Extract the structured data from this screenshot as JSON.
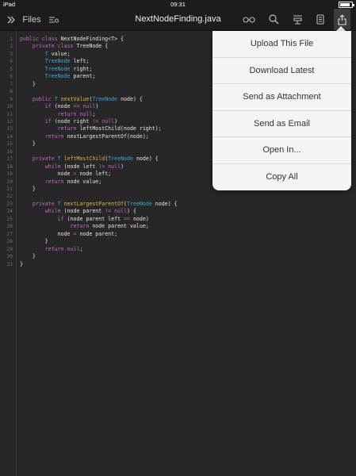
{
  "status_bar": {
    "device": "iPad",
    "time": "09:31"
  },
  "toolbar": {
    "files_label": "Files",
    "title": "NextNodeFinding.java",
    "icons": [
      "chevron-double-right-icon",
      "sort-list-icon",
      "glasses-icon",
      "search-icon",
      "snippets-icon",
      "document-icon",
      "share-icon"
    ]
  },
  "menu": {
    "items": [
      "Upload This File",
      "Download Latest",
      "Send as Attachment",
      "Send as Email",
      "Open In...",
      "Copy All"
    ]
  },
  "code": {
    "lines": [
      [
        [
          "kw",
          "public class "
        ],
        [
          "pl",
          "NextNodeFinding<T> {"
        ]
      ],
      [
        [
          "pl",
          "    "
        ],
        [
          "kw",
          "private class "
        ],
        [
          "pl",
          "TreeNode {"
        ]
      ],
      [
        [
          "pl",
          "        "
        ],
        [
          "ty",
          "T"
        ],
        [
          "pl",
          " value;"
        ]
      ],
      [
        [
          "pl",
          "        "
        ],
        [
          "ty",
          "TreeNode"
        ],
        [
          "pl",
          " left;"
        ]
      ],
      [
        [
          "pl",
          "        "
        ],
        [
          "ty",
          "TreeNode"
        ],
        [
          "pl",
          " right;"
        ]
      ],
      [
        [
          "pl",
          "        "
        ],
        [
          "ty",
          "TreeNode"
        ],
        [
          "pl",
          " parent;"
        ]
      ],
      [
        [
          "pl",
          "    }"
        ]
      ],
      [
        [
          "pl",
          ""
        ]
      ],
      [
        [
          "pl",
          "    "
        ],
        [
          "kw",
          "public "
        ],
        [
          "ty",
          "T "
        ],
        [
          "fn",
          "nextValue"
        ],
        [
          "pl",
          "("
        ],
        [
          "ty",
          "TreeNode"
        ],
        [
          "pl",
          " node) {"
        ]
      ],
      [
        [
          "pl",
          "        "
        ],
        [
          "kw",
          "if"
        ],
        [
          "pl",
          " (node "
        ],
        [
          "kw",
          "=="
        ],
        [
          "pl",
          " "
        ],
        [
          "kw",
          "null"
        ],
        [
          "pl",
          ")"
        ]
      ],
      [
        [
          "pl",
          "            "
        ],
        [
          "kw",
          "return null"
        ],
        [
          "pl",
          ";"
        ]
      ],
      [
        [
          "pl",
          "        "
        ],
        [
          "kw",
          "if"
        ],
        [
          "pl",
          " (node right "
        ],
        [
          "kw",
          "!="
        ],
        [
          "pl",
          " "
        ],
        [
          "kw",
          "null"
        ],
        [
          "pl",
          ")"
        ]
      ],
      [
        [
          "pl",
          "            "
        ],
        [
          "kw",
          "return"
        ],
        [
          "pl",
          " leftMostChild(node right);"
        ]
      ],
      [
        [
          "pl",
          "        "
        ],
        [
          "kw",
          "return"
        ],
        [
          "pl",
          " nextLargestParentOf(node);"
        ]
      ],
      [
        [
          "pl",
          "    }"
        ]
      ],
      [
        [
          "pl",
          ""
        ]
      ],
      [
        [
          "pl",
          "    "
        ],
        [
          "kw",
          "private "
        ],
        [
          "ty",
          "T "
        ],
        [
          "fn",
          "leftMostChild"
        ],
        [
          "pl",
          "("
        ],
        [
          "ty",
          "TreeNode"
        ],
        [
          "pl",
          " node) {"
        ]
      ],
      [
        [
          "pl",
          "        "
        ],
        [
          "kw",
          "while"
        ],
        [
          "pl",
          " (node left "
        ],
        [
          "kw",
          "!="
        ],
        [
          "pl",
          " "
        ],
        [
          "kw",
          "null"
        ],
        [
          "pl",
          ")"
        ]
      ],
      [
        [
          "pl",
          "            node "
        ],
        [
          "kw",
          "="
        ],
        [
          "pl",
          " node left;"
        ]
      ],
      [
        [
          "pl",
          "        "
        ],
        [
          "kw",
          "return"
        ],
        [
          "pl",
          " node value;"
        ]
      ],
      [
        [
          "pl",
          "    }"
        ]
      ],
      [
        [
          "pl",
          ""
        ]
      ],
      [
        [
          "pl",
          "    "
        ],
        [
          "kw",
          "private "
        ],
        [
          "ty",
          "T "
        ],
        [
          "fn",
          "nextLargestParentOf"
        ],
        [
          "pl",
          "("
        ],
        [
          "ty",
          "TreeNode"
        ],
        [
          "pl",
          " node) {"
        ]
      ],
      [
        [
          "pl",
          "        "
        ],
        [
          "kw",
          "while"
        ],
        [
          "pl",
          " (node parent "
        ],
        [
          "kw",
          "!="
        ],
        [
          "pl",
          " "
        ],
        [
          "kw",
          "null"
        ],
        [
          "pl",
          ") {"
        ]
      ],
      [
        [
          "pl",
          "            "
        ],
        [
          "kw",
          "if"
        ],
        [
          "pl",
          " (node parent left "
        ],
        [
          "kw",
          "=="
        ],
        [
          "pl",
          " node)"
        ]
      ],
      [
        [
          "pl",
          "                "
        ],
        [
          "kw",
          "return"
        ],
        [
          "pl",
          " node parent value;"
        ]
      ],
      [
        [
          "pl",
          "            node "
        ],
        [
          "kw",
          "="
        ],
        [
          "pl",
          " node parent;"
        ]
      ],
      [
        [
          "pl",
          "        }"
        ]
      ],
      [
        [
          "pl",
          "        "
        ],
        [
          "kw",
          "return null"
        ],
        [
          "pl",
          ";"
        ]
      ],
      [
        [
          "pl",
          "    }"
        ]
      ],
      [
        [
          "pl",
          "}"
        ]
      ]
    ]
  },
  "colors": {
    "keyword": "#cc66cc",
    "type": "#38a8d8",
    "function": "#e6b34d",
    "plain": "#e6e6e6",
    "background": "#272727"
  }
}
